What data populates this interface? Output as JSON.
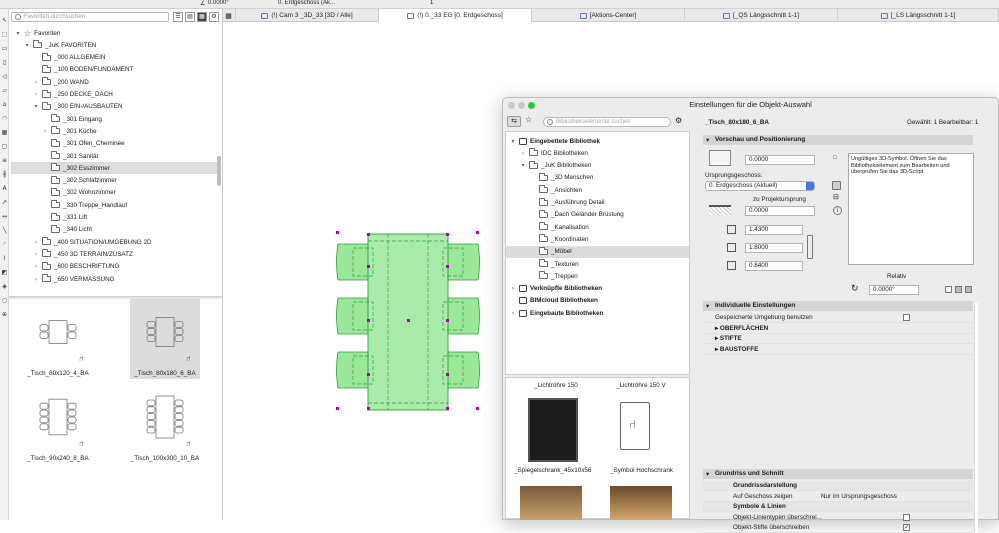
{
  "topbar": {
    "angle_value": "0.0000°",
    "story_tab": "0. Erdgeschoss (Ak...",
    "counter": "1"
  },
  "tabs": [
    {
      "label": "(!) Cam 3 _3D_33 [3D / Alle]",
      "active": false
    },
    {
      "label": "(!) 0._33 EG [0. Erdgeschoss]",
      "active": true
    },
    {
      "label": "[Aktions-Center]",
      "active": false
    },
    {
      "label": "[_QS Längsschnitt 1-1]",
      "active": false
    },
    {
      "label": "[_LS Längsschnitt 1-1]",
      "active": false
    }
  ],
  "navigator": {
    "search_placeholder": "Favoriten durchsuchen",
    "tree": [
      {
        "label": "Favoriten",
        "level": 0,
        "chev": "▾",
        "icon": "star"
      },
      {
        "label": "_JuK FAVORITEN",
        "level": 1,
        "chev": "▾",
        "icon": "folder"
      },
      {
        "label": "_000  ALLGEMEIN",
        "level": 2,
        "chev": "",
        "icon": "folder"
      },
      {
        "label": "_100  BODEN/FUNDAMENT",
        "level": 2,
        "chev": "",
        "icon": "folder"
      },
      {
        "label": "_200  WAND",
        "level": 2,
        "chev": "›",
        "icon": "folder"
      },
      {
        "label": "_250  DECKE_DACH",
        "level": 2,
        "chev": "›",
        "icon": "folder"
      },
      {
        "label": "_300  EIN-/AUSBAUTEN",
        "level": 2,
        "chev": "▾",
        "icon": "folder"
      },
      {
        "label": "_301 Eingang",
        "level": 3,
        "chev": "",
        "icon": "folder"
      },
      {
        "label": "_301 Küche",
        "level": 3,
        "chev": "›",
        "icon": "folder"
      },
      {
        "label": "_301 Ofen_Cheminee",
        "level": 3,
        "chev": "",
        "icon": "folder"
      },
      {
        "label": "_301 Sanitär",
        "level": 3,
        "chev": "",
        "icon": "folder"
      },
      {
        "label": "_302 Esszimmer",
        "level": 3,
        "chev": "",
        "icon": "folder",
        "selected": true
      },
      {
        "label": "_302 Schlafzimmer",
        "level": 3,
        "chev": "",
        "icon": "folder"
      },
      {
        "label": "_302 Wohnzimmer",
        "level": 3,
        "chev": "",
        "icon": "folder"
      },
      {
        "label": "_330 Treppe_Handlauf",
        "level": 3,
        "chev": "",
        "icon": "folder"
      },
      {
        "label": "_331 Lift",
        "level": 3,
        "chev": "",
        "icon": "folder"
      },
      {
        "label": "_340 Licht",
        "level": 3,
        "chev": "",
        "icon": "folder"
      },
      {
        "label": "_400  SITUATION/UMGEBUNG 2D",
        "level": 2,
        "chev": "›",
        "icon": "folder"
      },
      {
        "label": "_450  3D TERRAIN/ZUSATZ",
        "level": 2,
        "chev": "›",
        "icon": "folder"
      },
      {
        "label": "_600  BESCHRIFTUNG",
        "level": 2,
        "chev": "›",
        "icon": "folder"
      },
      {
        "label": "_650  VERMASSUNG",
        "level": 2,
        "chev": "›",
        "icon": "folder"
      }
    ],
    "cards": [
      {
        "label": "_Tisch_80x120_4_BA",
        "selected": false
      },
      {
        "label": "_Tisch_80x180_6_BA",
        "selected": true
      },
      {
        "label": "_Tisch_90x240_8_BA",
        "selected": false
      },
      {
        "label": "_Tisch_100x300_10_BA",
        "selected": false
      }
    ]
  },
  "dialog": {
    "title": "Einstellungen für die Objekt-Auswahl",
    "lib_search_placeholder": "Bibliothekselemente suchen",
    "lib_tree": [
      {
        "label": "Eingebettete Bibliothek",
        "level": 0,
        "chev": "▾",
        "bold": true
      },
      {
        "label": "IDC Bibliotheken",
        "level": 1,
        "chev": "›"
      },
      {
        "label": "_JuK Bibliotheken",
        "level": 1,
        "chev": "▾"
      },
      {
        "label": "_3D Menschen",
        "level": 2,
        "chev": ""
      },
      {
        "label": "_Ansichten",
        "level": 2,
        "chev": ""
      },
      {
        "label": "_Ausführung Detail",
        "level": 2,
        "chev": ""
      },
      {
        "label": "_Dach Geländer Brüstung",
        "level": 2,
        "chev": ""
      },
      {
        "label": "_Kanalisation",
        "level": 2,
        "chev": ""
      },
      {
        "label": "_Koordinaten",
        "level": 2,
        "chev": ""
      },
      {
        "label": "_Möbel",
        "level": 2,
        "chev": "",
        "selected": true
      },
      {
        "label": "_Texturen",
        "level": 2,
        "chev": ""
      },
      {
        "label": "_Treppen",
        "level": 2,
        "chev": ""
      },
      {
        "label": "Verknüpfte Bibliotheken",
        "level": 0,
        "chev": "›",
        "bold": true
      },
      {
        "label": "BIMcloud Bibliotheken",
        "level": 0,
        "chev": "",
        "bold": true
      },
      {
        "label": "Eingebaute Bibliotheken",
        "level": 0,
        "chev": "›",
        "bold": true
      }
    ],
    "preview_items": [
      "_Lichtröhre 150",
      "_Lichtröhre 150 V",
      "_Spiegelschrank_45x10x56",
      "_Symbol Hochschrank"
    ],
    "object_name": "_Tisch_80x180_6_BA",
    "selection_info": "Gewählt: 1 Bearbeitbar: 1",
    "section_preview": "Vorschau und Positionierung",
    "elev_value": "0.0000",
    "origin_label": "Ursprungsgeschoss:",
    "origin_value": "0. Erdgeschoss (Aktuell)",
    "project_zero_label": "zu Projektursprung",
    "offset_value": "0.0000",
    "dim_x": "1.4300",
    "dim_y": "1.8000",
    "dim_z": "0.8400",
    "warning": "Ungültiges 3D-Symbol. Öffnen Sie das Bibliothekselement zum Bearbeiten und überprüfen Sie das 3D-Script.",
    "relative_label": "Relativ",
    "angle": "0.0000°",
    "section_individual": "Individuelle Einstellungen",
    "indiv_rows": [
      {
        "label": "Gespeicherte Umgebung benutzen",
        "type": "checkbox",
        "checked": false
      },
      {
        "label": "OBERFLÄCHEN",
        "type": "group"
      },
      {
        "label": "STIFTE",
        "type": "group"
      },
      {
        "label": "BAUSTOFFE",
        "type": "group"
      }
    ],
    "section_plan": "Grundriss und Schnitt",
    "plan_rows": [
      {
        "label": "Grundrissdarstellung",
        "type": "subhead"
      },
      {
        "label": "Auf Geschoss zeigen",
        "value": "Nur im Ursprungsgeschoss",
        "type": "value"
      },
      {
        "label": "Symbole & Linien",
        "type": "subhead"
      },
      {
        "label": "Objekt-Linientypen überschrei...",
        "type": "checkbox",
        "checked": false
      },
      {
        "label": "Objekt-Stifte überschreiben",
        "type": "checkbox",
        "checked": true
      }
    ]
  },
  "colors": {
    "accent": "#3b7ae0",
    "selection": "#dcdcdc",
    "object_fill": "#9be89b",
    "object_stroke": "#2f9e3a",
    "handle": "#b000b0"
  }
}
